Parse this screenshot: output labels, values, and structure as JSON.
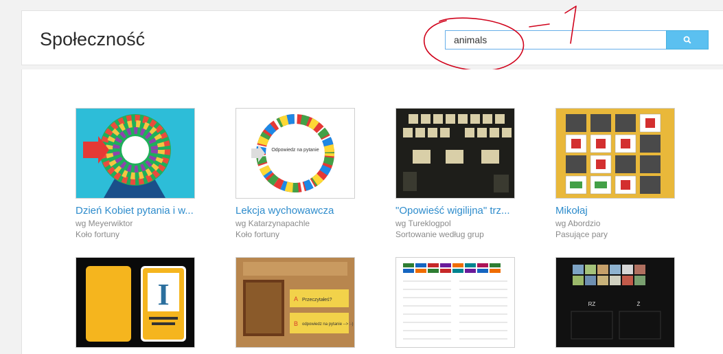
{
  "header": {
    "title": "Społeczność",
    "search": {
      "value": "animals",
      "placeholder": ""
    },
    "annotation_text": "-1"
  },
  "items": [
    {
      "title": "Dzień Kobiet pytania i w...",
      "author": "wg Meyerwiktor",
      "type": "Koło fortuny"
    },
    {
      "title": "Lekcja wychowawcza",
      "author": "wg Katarzynapachle",
      "type": "Koło fortuny",
      "thumb_text": "Odpowiedz na pytanie"
    },
    {
      "title": "\"Opowieść wigilijna\" trz...",
      "author": "wg Tureklogpol",
      "type": "Sortowanie według grup"
    },
    {
      "title": "Mikołaj",
      "author": "wg Abordzio",
      "type": "Pasujące pary"
    },
    {
      "title": "",
      "author": "",
      "type": "",
      "thumb_text": "I"
    },
    {
      "title": "",
      "author": "",
      "type": "",
      "thumb_text": "Przeczytałeś?",
      "thumb_text_2": "odpowiedz na pytanie --> :-)"
    },
    {
      "title": "",
      "author": "",
      "type": ""
    },
    {
      "title": "",
      "author": "",
      "type": "",
      "thumb_text": "RZ",
      "thumb_text_2": "Ż"
    }
  ],
  "colors": {
    "link": "#2e8ccc",
    "button": "#5bc0f0",
    "annotation": "#d0021b"
  }
}
